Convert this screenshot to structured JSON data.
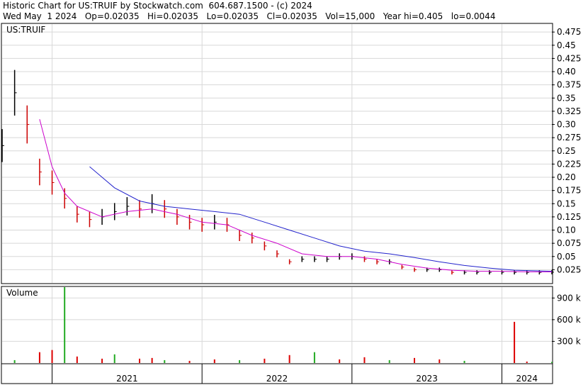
{
  "header": {
    "line1": "Historic Chart for US:TRUIF by Stockwatch.com  604.687.1500 - (c) 2024",
    "line2": "Wed May  1 2024   Op=0.02035   Hi=0.02035   Lo=0.02035   Cl=0.02035   Vol=15,000   Year hi=0.405   lo=0.0044"
  },
  "chart_data": {
    "type": "line",
    "symbol_label": "US:TRUIF",
    "volume_label": "Volume",
    "price_axis": {
      "ticks": [
        0.025,
        0.05,
        0.075,
        0.1,
        0.125,
        0.15,
        0.175,
        0.2,
        0.225,
        0.25,
        0.275,
        0.3,
        0.325,
        0.35,
        0.375,
        0.4,
        0.425,
        0.45,
        0.475
      ],
      "tick_labels": [
        "0.025",
        "0.05",
        "0.075",
        "0.10",
        "0.125",
        "0.15",
        "0.175",
        "0.20",
        "0.225",
        "0.25",
        "0.275",
        "0.30",
        "0.325",
        "0.35",
        "0.375",
        "0.40",
        "0.425",
        "0.45",
        "0.475"
      ],
      "range": [
        0,
        0.49
      ],
      "side": "right"
    },
    "volume_axis": {
      "ticks": [
        300000,
        600000,
        900000
      ],
      "tick_labels": [
        "300 k",
        "600 k",
        "900 k"
      ],
      "range": [
        0,
        1050000
      ],
      "side": "right"
    },
    "x_axis": {
      "labels": [
        "2021",
        "2022",
        "2023",
        "2024"
      ],
      "range": [
        "2020-09",
        "2024-05"
      ]
    },
    "grid": true,
    "series": [
      {
        "kind": "price-bars",
        "color": "#000000",
        "down_color": "#cc0000",
        "points": [
          [
            "2020-09",
            0.26
          ],
          [
            "2020-10",
            0.36
          ],
          [
            "2020-11",
            0.3
          ],
          [
            "2020-12",
            0.21
          ],
          [
            "2021-01",
            0.19
          ],
          [
            "2021-02",
            0.16
          ],
          [
            "2021-03",
            0.13
          ],
          [
            "2021-04",
            0.12
          ],
          [
            "2021-05",
            0.125
          ],
          [
            "2021-06",
            0.135
          ],
          [
            "2021-07",
            0.145
          ],
          [
            "2021-08",
            0.14
          ],
          [
            "2021-09",
            0.15
          ],
          [
            "2021-10",
            0.14
          ],
          [
            "2021-11",
            0.125
          ],
          [
            "2021-12",
            0.115
          ],
          [
            "2022-01",
            0.11
          ],
          [
            "2022-02",
            0.115
          ],
          [
            "2022-03",
            0.11
          ],
          [
            "2022-04",
            0.09
          ],
          [
            "2022-05",
            0.085
          ],
          [
            "2022-06",
            0.07
          ],
          [
            "2022-07",
            0.055
          ],
          [
            "2022-08",
            0.04
          ],
          [
            "2022-09",
            0.045
          ],
          [
            "2022-10",
            0.045
          ],
          [
            "2022-11",
            0.045
          ],
          [
            "2022-12",
            0.05
          ],
          [
            "2023-01",
            0.05
          ],
          [
            "2023-02",
            0.045
          ],
          [
            "2023-03",
            0.04
          ],
          [
            "2023-04",
            0.04
          ],
          [
            "2023-05",
            0.03
          ],
          [
            "2023-06",
            0.025
          ],
          [
            "2023-07",
            0.025
          ],
          [
            "2023-08",
            0.025
          ],
          [
            "2023-09",
            0.02
          ],
          [
            "2023-10",
            0.02
          ],
          [
            "2023-11",
            0.02
          ],
          [
            "2023-12",
            0.02
          ],
          [
            "2024-01",
            0.02
          ],
          [
            "2024-02",
            0.02
          ],
          [
            "2024-03",
            0.02
          ],
          [
            "2024-04",
            0.02
          ],
          [
            "2024-05",
            0.02035
          ]
        ]
      },
      {
        "kind": "moving-average-short",
        "color": "#cc00cc",
        "points": [
          [
            "2020-12",
            0.31
          ],
          [
            "2021-01",
            0.22
          ],
          [
            "2021-02",
            0.17
          ],
          [
            "2021-03",
            0.145
          ],
          [
            "2021-05",
            0.125
          ],
          [
            "2021-07",
            0.135
          ],
          [
            "2021-09",
            0.14
          ],
          [
            "2021-11",
            0.13
          ],
          [
            "2022-01",
            0.115
          ],
          [
            "2022-03",
            0.11
          ],
          [
            "2022-05",
            0.09
          ],
          [
            "2022-07",
            0.075
          ],
          [
            "2022-09",
            0.055
          ],
          [
            "2022-11",
            0.05
          ],
          [
            "2023-01",
            0.05
          ],
          [
            "2023-03",
            0.045
          ],
          [
            "2023-05",
            0.035
          ],
          [
            "2023-07",
            0.028
          ],
          [
            "2023-09",
            0.024
          ],
          [
            "2023-11",
            0.022
          ],
          [
            "2024-01",
            0.022
          ],
          [
            "2024-03",
            0.021
          ],
          [
            "2024-05",
            0.021
          ]
        ]
      },
      {
        "kind": "moving-average-long",
        "color": "#2222cc",
        "points": [
          [
            "2021-04",
            0.22
          ],
          [
            "2021-06",
            0.18
          ],
          [
            "2021-08",
            0.155
          ],
          [
            "2021-10",
            0.145
          ],
          [
            "2021-12",
            0.14
          ],
          [
            "2022-02",
            0.135
          ],
          [
            "2022-04",
            0.13
          ],
          [
            "2022-06",
            0.115
          ],
          [
            "2022-08",
            0.1
          ],
          [
            "2022-10",
            0.085
          ],
          [
            "2022-12",
            0.07
          ],
          [
            "2023-02",
            0.06
          ],
          [
            "2023-04",
            0.055
          ],
          [
            "2023-06",
            0.048
          ],
          [
            "2023-08",
            0.04
          ],
          [
            "2023-10",
            0.033
          ],
          [
            "2023-12",
            0.028
          ],
          [
            "2024-02",
            0.024
          ],
          [
            "2024-05",
            0.022
          ]
        ]
      },
      {
        "kind": "volume",
        "up_color": "#22aa22",
        "down_color": "#dd0000",
        "points": [
          [
            "2020-10",
            40000
          ],
          [
            "2020-12",
            150000
          ],
          [
            "2021-01",
            180000
          ],
          [
            "2021-02",
            1050000
          ],
          [
            "2021-03",
            90000
          ],
          [
            "2021-05",
            60000
          ],
          [
            "2021-06",
            120000
          ],
          [
            "2021-08",
            60000
          ],
          [
            "2021-09",
            70000
          ],
          [
            "2021-10",
            40000
          ],
          [
            "2021-12",
            30000
          ],
          [
            "2022-02",
            50000
          ],
          [
            "2022-04",
            40000
          ],
          [
            "2022-06",
            60000
          ],
          [
            "2022-08",
            110000
          ],
          [
            "2022-10",
            150000
          ],
          [
            "2022-12",
            50000
          ],
          [
            "2023-02",
            80000
          ],
          [
            "2023-04",
            40000
          ],
          [
            "2023-06",
            70000
          ],
          [
            "2023-08",
            50000
          ],
          [
            "2023-10",
            30000
          ],
          [
            "2024-02",
            570000
          ],
          [
            "2024-03",
            20000
          ],
          [
            "2024-05",
            15000
          ]
        ]
      }
    ]
  }
}
